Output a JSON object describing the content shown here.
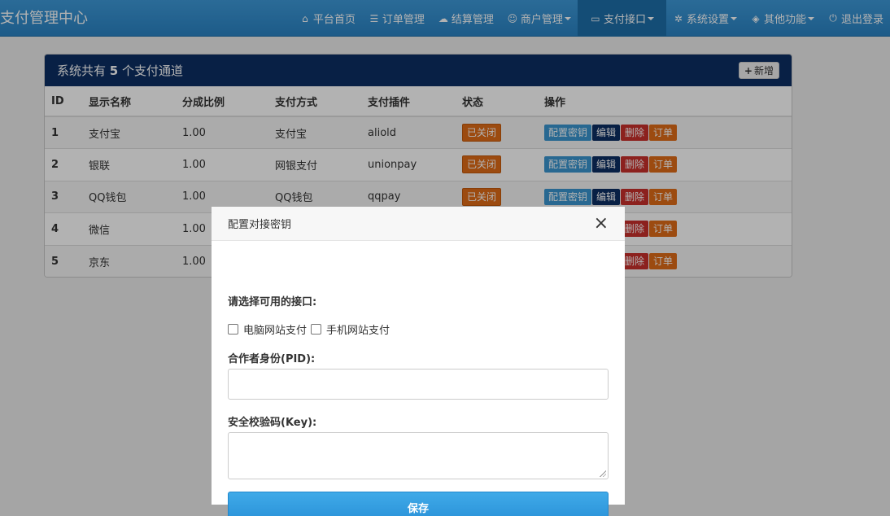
{
  "app": {
    "brand": "支付管理中心"
  },
  "nav": [
    {
      "icon": "home-icon",
      "glyph": "⌂",
      "label": "平台首页",
      "dropdown": false,
      "active": false
    },
    {
      "icon": "list-icon",
      "glyph": "☰",
      "label": "订单管理",
      "dropdown": false,
      "active": false
    },
    {
      "icon": "cloud-icon",
      "glyph": "☁",
      "label": "结算管理",
      "dropdown": false,
      "active": false
    },
    {
      "icon": "user-icon",
      "glyph": "☺",
      "label": "商户管理",
      "dropdown": true,
      "active": false
    },
    {
      "icon": "credit-card-icon",
      "glyph": "▭",
      "label": "支付接口",
      "dropdown": true,
      "active": true
    },
    {
      "icon": "gear-icon",
      "glyph": "✲",
      "label": "系统设置",
      "dropdown": true,
      "active": false
    },
    {
      "icon": "cube-icon",
      "glyph": "◈",
      "label": "其他功能",
      "dropdown": true,
      "active": false
    },
    {
      "icon": "power-icon",
      "glyph": "⏻",
      "label": "退出登录",
      "dropdown": false,
      "active": false
    }
  ],
  "panel": {
    "title_prefix": "系统共有 ",
    "count": "5",
    "title_suffix": " 个支付通道",
    "add_label": "新增"
  },
  "table": {
    "headers": [
      "ID",
      "显示名称",
      "分成比例",
      "支付方式",
      "支付插件",
      "状态",
      "操作"
    ],
    "rows": [
      {
        "id": "1",
        "name": "支付宝",
        "ratio": "1.00",
        "method": "支付宝",
        "plugin": "aliold",
        "status": "已关闭"
      },
      {
        "id": "2",
        "name": "银联",
        "ratio": "1.00",
        "method": "网银支付",
        "plugin": "unionpay",
        "status": "已关闭"
      },
      {
        "id": "3",
        "name": "QQ钱包",
        "ratio": "1.00",
        "method": "QQ钱包",
        "plugin": "qqpay",
        "status": "已关闭"
      },
      {
        "id": "4",
        "name": "微信",
        "ratio": "1.00",
        "method": "",
        "plugin": "",
        "status": ""
      },
      {
        "id": "5",
        "name": "京东",
        "ratio": "1.00",
        "method": "",
        "plugin": "",
        "status": ""
      }
    ],
    "actions": {
      "config": "配置密钥",
      "edit": "编辑",
      "delete": "删除",
      "order": "订单"
    }
  },
  "modal": {
    "title": "配置对接密钥",
    "close_glyph": "×",
    "interface_label": "请选择可用的接口:",
    "options": [
      "电脑网站支付",
      "手机网站支付"
    ],
    "pid_label": "合作者身份(PID):",
    "pid_value": "",
    "key_label": "安全校验码(Key):",
    "key_value": "",
    "save_label": "保存"
  },
  "colors": {
    "navbar": "#2a83c4",
    "panel_heading": "#0c2f63",
    "status_off": "#e06c17",
    "config_btn": "#3a96d0",
    "edit_btn": "#0c2f63",
    "delete_btn": "#c9302c",
    "order_btn": "#e06c17",
    "save_btn": "#2a91d8"
  }
}
